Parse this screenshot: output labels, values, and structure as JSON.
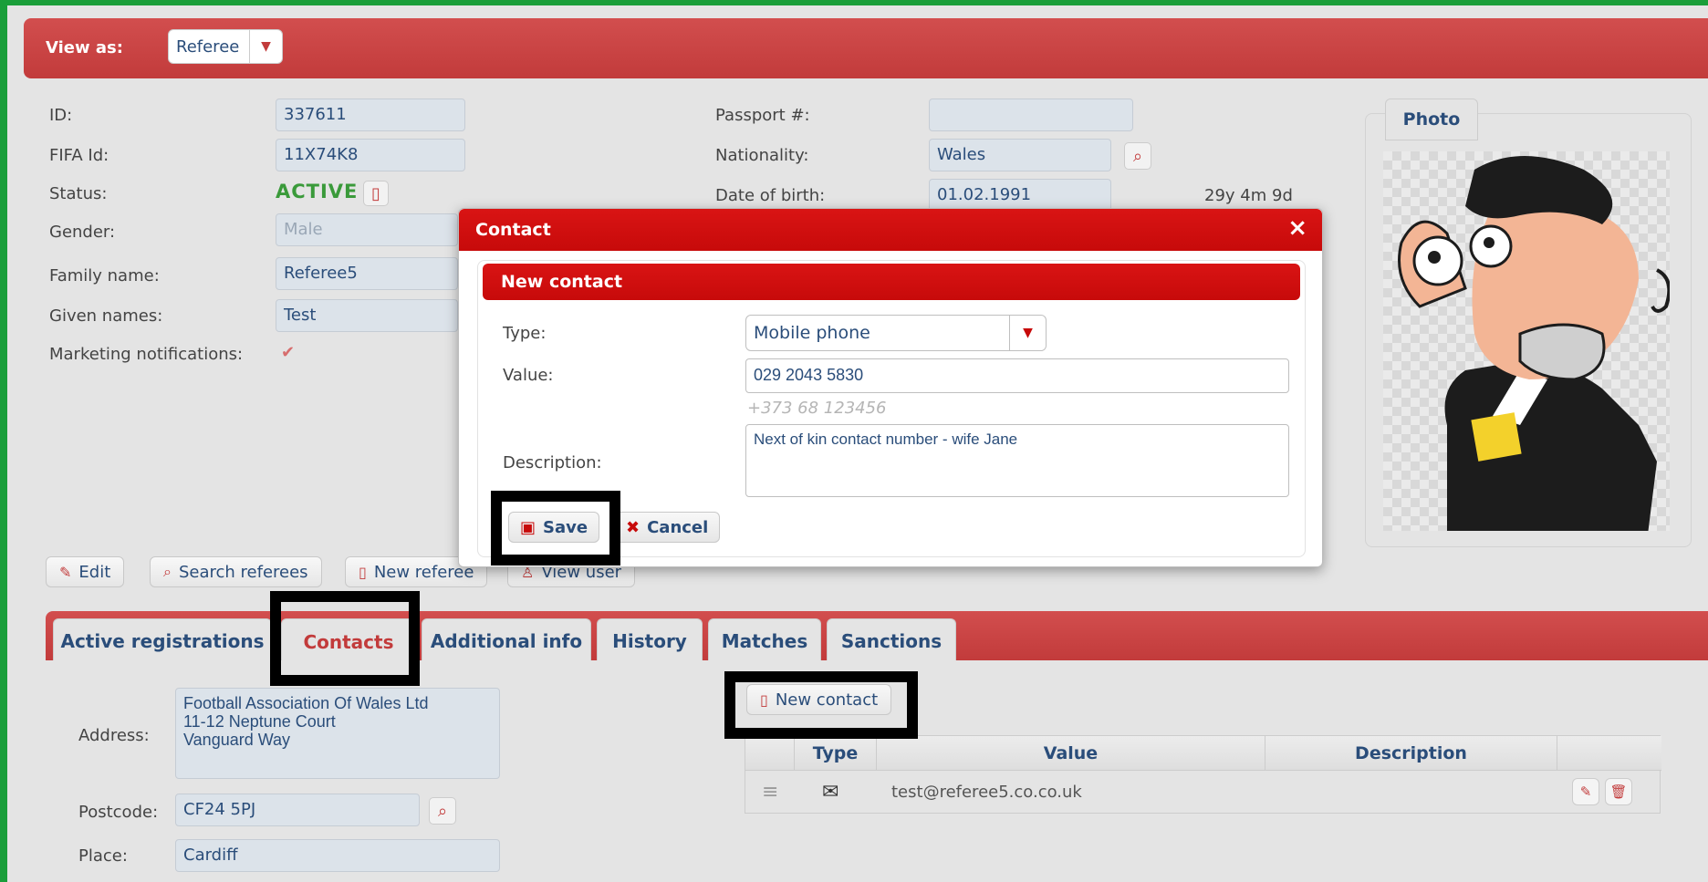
{
  "header": {
    "view_as_label": "View as:",
    "view_as_value": "Referee"
  },
  "details": {
    "id_label": "ID:",
    "id_value": "337611",
    "fifa_label": "FIFA Id:",
    "fifa_value": "11X74K8",
    "status_label": "Status:",
    "status_value": "ACTIVE",
    "gender_label": "Gender:",
    "gender_value": "Male",
    "family_label": "Family name:",
    "family_value": "Referee5",
    "given_label": "Given names:",
    "given_value": "Test",
    "marketing_label": "Marketing notifications:",
    "passport_label": "Passport #:",
    "passport_value": "",
    "nationality_label": "Nationality:",
    "nationality_value": "Wales",
    "dob_label": "Date of birth:",
    "dob_value": "01.02.1991",
    "age_value": "29y 4m 9d"
  },
  "photo": {
    "title": "Photo"
  },
  "actions": {
    "edit": "Edit",
    "search": "Search referees",
    "new_referee": "New referee",
    "view_user": "View user"
  },
  "tabs": [
    {
      "label": "Active registrations"
    },
    {
      "label": "Contacts"
    },
    {
      "label": "Additional info"
    },
    {
      "label": "History"
    },
    {
      "label": "Matches"
    },
    {
      "label": "Sanctions"
    }
  ],
  "contacts_tab": {
    "address_label": "Address:",
    "address_lines": [
      "Football Association Of Wales Ltd",
      "11-12 Neptune Court",
      "Vanguard Way"
    ],
    "postcode_label": "Postcode:",
    "postcode_value": "CF24 5PJ",
    "place_label": "Place:",
    "place_value": "Cardiff",
    "new_contact": "New contact",
    "table": {
      "headers": [
        "Type",
        "Value",
        "Description"
      ],
      "rows": [
        {
          "value": "test@referee5.co.co.uk",
          "description": ""
        }
      ]
    }
  },
  "modal": {
    "title": "Contact",
    "subtitle": "New contact",
    "type_label": "Type:",
    "type_value": "Mobile phone",
    "value_label": "Value:",
    "value_value": "029 2043 5830",
    "value_hint": "+373 68 123456",
    "description_label": "Description:",
    "description_value": "Next of kin contact number - wife Jane",
    "save": "Save",
    "cancel": "Cancel"
  },
  "colors": {
    "accent": "#c23b3b",
    "modal_red": "#c70a0a",
    "active_green": "#3a9a3a",
    "frame": "#1a9e3a"
  }
}
